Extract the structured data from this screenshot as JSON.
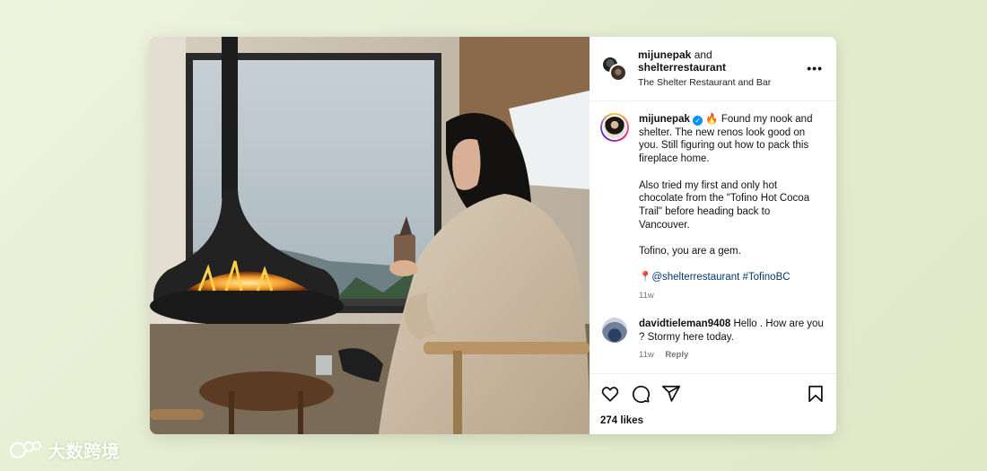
{
  "post": {
    "header": {
      "user1": "mijunepak",
      "and_word": "and",
      "user2": "shelterrestaurant",
      "location": "The Shelter Restaurant and Bar",
      "more_label": "•••"
    },
    "caption": {
      "username": "mijunepak",
      "verified_mark": "✓",
      "fire_emoji": "🔥",
      "line1": "Found my nook and shelter. The new renos look good on you. Still figuring out how to pack this fireplace home.",
      "line2": "Also tried my first and only hot chocolate from the \"Tofino Hot Cocoa Trail\" before heading back to Vancouver.",
      "line3": "Tofino, you are a gem.",
      "pin_emoji": "📍",
      "tags": "@shelterrestaurant #TofinoBC",
      "time": "11w"
    },
    "comment": {
      "username": "davidtieleman9408",
      "text": "Hello . How are you ? Stormy here today.",
      "time": "11w",
      "reply_label": "Reply"
    },
    "likes": "274 likes",
    "icons": [
      "heart-icon",
      "comment-icon",
      "share-icon",
      "bookmark-icon"
    ]
  },
  "watermark": {
    "text": "大数跨境"
  },
  "colors": {
    "verified": "#0095f6",
    "hashtag": "#00376b",
    "meta": "#737373"
  }
}
